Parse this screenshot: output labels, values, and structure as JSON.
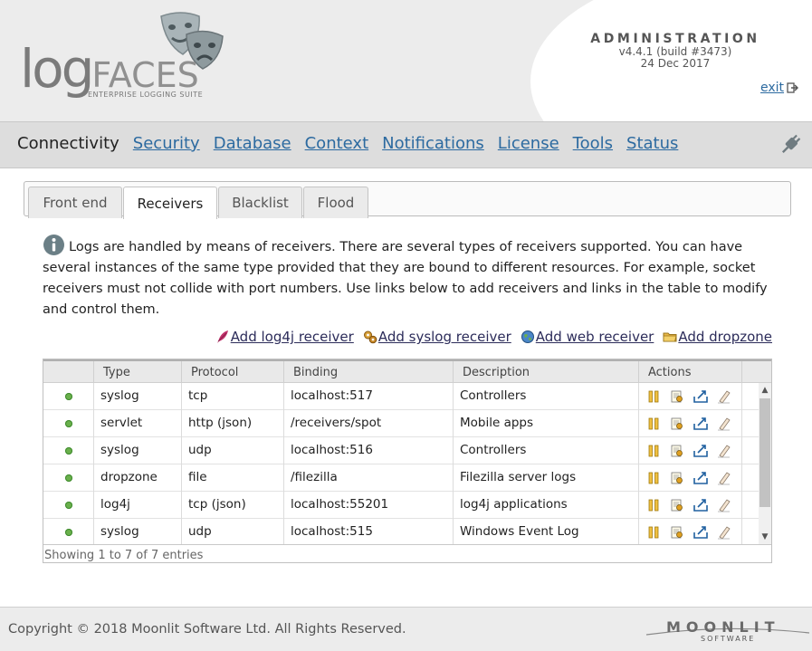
{
  "header": {
    "logo": {
      "log": "log",
      "faces": "FACES",
      "tagline": "ENTERPRISE LOGGING SUITE"
    },
    "admin_title": "ADMINISTRATION",
    "version": "v4.4.1 (build #3473)",
    "date": "24 Dec 2017",
    "exit_label": "exit"
  },
  "nav": {
    "items": [
      {
        "label": "Connectivity",
        "active": true
      },
      {
        "label": "Security"
      },
      {
        "label": "Database"
      },
      {
        "label": "Context"
      },
      {
        "label": "Notifications"
      },
      {
        "label": "License"
      },
      {
        "label": "Tools"
      },
      {
        "label": "Status"
      }
    ]
  },
  "tabs": [
    {
      "label": "Front end"
    },
    {
      "label": "Receivers",
      "active": true
    },
    {
      "label": "Blacklist"
    },
    {
      "label": "Flood"
    }
  ],
  "info_text": "Logs are handled by means of receivers. There are several types of receivers supported. You can have several instances of the same type provided that they are bound to different resources. For example, socket receivers must not collide with port numbers. Use links below to add receivers and links in the table to modify and control them.",
  "add_links": {
    "log4j": "Add log4j receiver",
    "syslog": "Add syslog receiver",
    "web": "Add web receiver",
    "dropzone": "Add dropzone"
  },
  "table": {
    "columns": [
      "",
      "Type",
      "Protocol",
      "Binding",
      "Description",
      "Actions"
    ],
    "rows": [
      {
        "type": "syslog",
        "protocol": "tcp",
        "binding": "localhost:517",
        "description": "Controllers"
      },
      {
        "type": "servlet",
        "protocol": "http (json)",
        "binding": "/receivers/spot",
        "description": "Mobile apps"
      },
      {
        "type": "syslog",
        "protocol": "udp",
        "binding": "localhost:516",
        "description": "Controllers"
      },
      {
        "type": "dropzone",
        "protocol": "file",
        "binding": "/filezilla",
        "description": "Filezilla server logs"
      },
      {
        "type": "log4j",
        "protocol": "tcp (json)",
        "binding": "localhost:55201",
        "description": "log4j applications"
      },
      {
        "type": "syslog",
        "protocol": "udp",
        "binding": "localhost:515",
        "description": "Windows Event Log"
      }
    ],
    "footer": "Showing 1 to 7 of 7 entries"
  },
  "footer": {
    "copyright": "Copyright © 2018 Moonlit Software Ltd. All Rights Reserved.",
    "brand": "MOONLIT",
    "brand_sub": "SOFTWARE"
  },
  "colors": {
    "link": "#2c6aa0",
    "status_ok": "#6ab04c",
    "nav_bg": "#dddddd"
  }
}
